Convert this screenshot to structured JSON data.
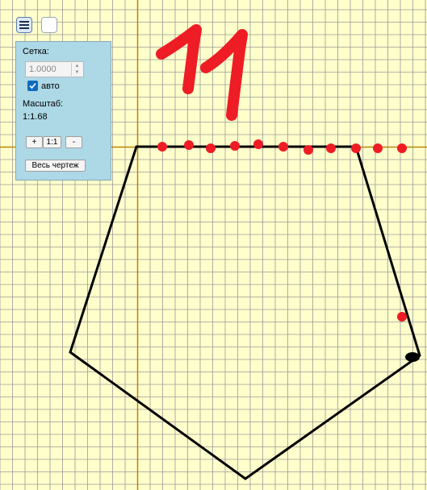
{
  "toolbar": {
    "menu_icon": "hamburger-icon"
  },
  "panel": {
    "grid_label": "Сетка:",
    "grid_value": "1.0000",
    "auto_label": "авто",
    "auto_checked": true,
    "scale_label": "Масштаб:",
    "scale_value": "1:1.68",
    "zoom_in_label": "+",
    "scale_1to1_label": "1:1",
    "zoom_out_label": "-",
    "fit_all_label": "Весь чертеж"
  },
  "drawing": {
    "handwritten_text": "11",
    "colors": {
      "background": "#ffffcc",
      "grid": "#999999",
      "axis": "#b8860b",
      "shape": "#000000",
      "points": "#ee1c24"
    }
  }
}
